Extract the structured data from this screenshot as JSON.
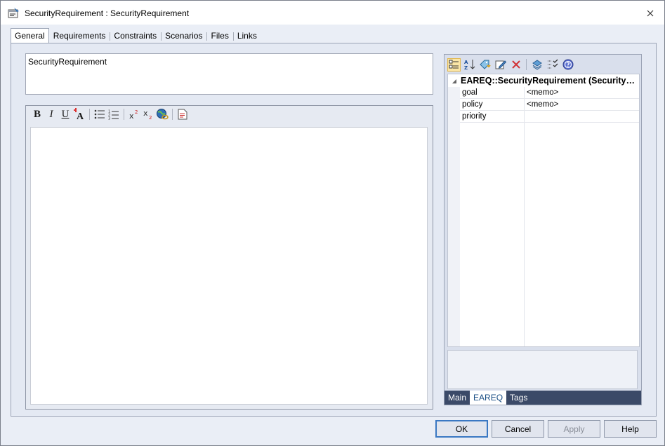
{
  "window": {
    "title": "SecurityRequirement : SecurityRequirement"
  },
  "tabs": [
    {
      "label": "General",
      "active": true
    },
    {
      "label": "Requirements"
    },
    {
      "label": "Constraints"
    },
    {
      "label": "Scenarios"
    },
    {
      "label": "Files"
    },
    {
      "label": "Links"
    }
  ],
  "name_field": {
    "value": "SecurityRequirement"
  },
  "editor_toolbar": [
    "bold",
    "italic",
    "underline",
    "font-color",
    "bullet-list",
    "numbered-list",
    "superscript",
    "subscript",
    "hyperlink",
    "document"
  ],
  "properties": {
    "group_title": "EAREQ::SecurityRequirement (SecurityRequirement)",
    "rows": [
      {
        "key": "goal",
        "value": "<memo>"
      },
      {
        "key": "policy",
        "value": "<memo>"
      },
      {
        "key": "priority",
        "value": ""
      }
    ],
    "tabs": [
      {
        "label": "Main"
      },
      {
        "label": "EAREQ",
        "active": true
      },
      {
        "label": "Tags"
      }
    ]
  },
  "buttons": {
    "ok": "OK",
    "cancel": "Cancel",
    "apply": "Apply",
    "help": "Help"
  },
  "colors": {
    "accent": "#3a78c3",
    "tab_bar": "#3b4a68",
    "active_tool": "#fbe6a6"
  }
}
